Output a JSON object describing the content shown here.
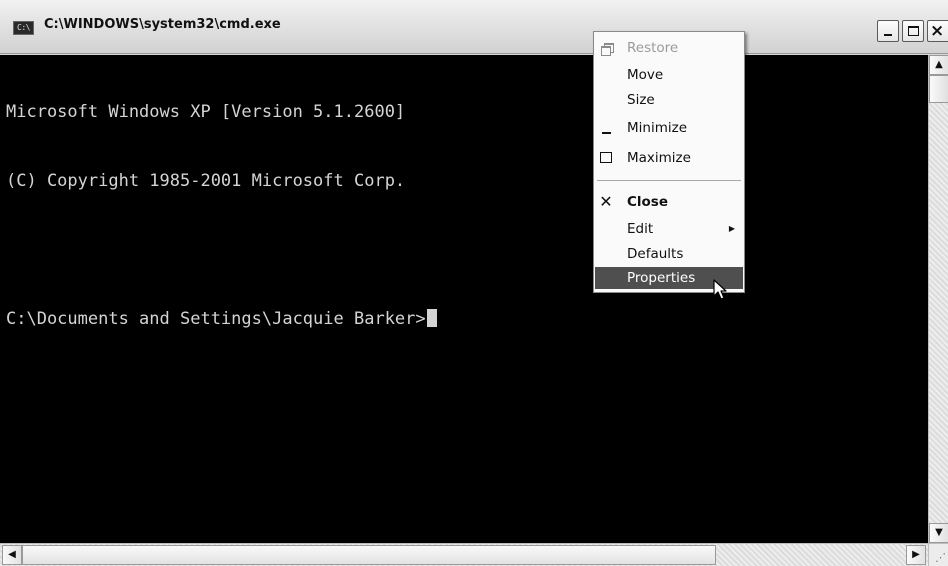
{
  "window": {
    "title": "C:\\WINDOWS\\system32\\cmd.exe",
    "icon_label": "C:\\",
    "controls": {
      "minimize": "minimize-button",
      "maximize": "maximize-button",
      "close": "close-button"
    }
  },
  "console": {
    "lines": [
      "Microsoft Windows XP [Version 5.1.2600]",
      "(C) Copyright 1985-2001 Microsoft Corp.",
      "",
      "C:\\Documents and Settings\\Jacquie Barker>"
    ],
    "text_color": "#d4d4d4",
    "background": "#000000"
  },
  "system_menu": {
    "items": [
      {
        "label": "Restore",
        "icon": "restore-icon",
        "disabled": true
      },
      {
        "label": "Move",
        "icon": "",
        "disabled": false
      },
      {
        "label": "Size",
        "icon": "",
        "disabled": false
      },
      {
        "label": "Minimize",
        "icon": "minimize-icon",
        "disabled": false
      },
      {
        "label": "Maximize",
        "icon": "maximize-icon",
        "disabled": false
      },
      {
        "label": "Close",
        "icon": "close-icon",
        "disabled": false,
        "bold": true
      },
      {
        "label": "Edit",
        "icon": "",
        "disabled": false,
        "submenu": true
      },
      {
        "label": "Defaults",
        "icon": "",
        "disabled": false
      },
      {
        "label": "Properties",
        "icon": "",
        "disabled": false,
        "highlighted": true
      }
    ],
    "highlight_color": "#4f4f4f"
  },
  "scrollbars": {
    "up_arrow": "▲",
    "down_arrow": "▼",
    "left_arrow": "◀",
    "right_arrow": "▶"
  },
  "symbols": {
    "submenu_arrow": "▶",
    "close_x": "✕",
    "title_close": "×",
    "size_grip": "⋰"
  }
}
